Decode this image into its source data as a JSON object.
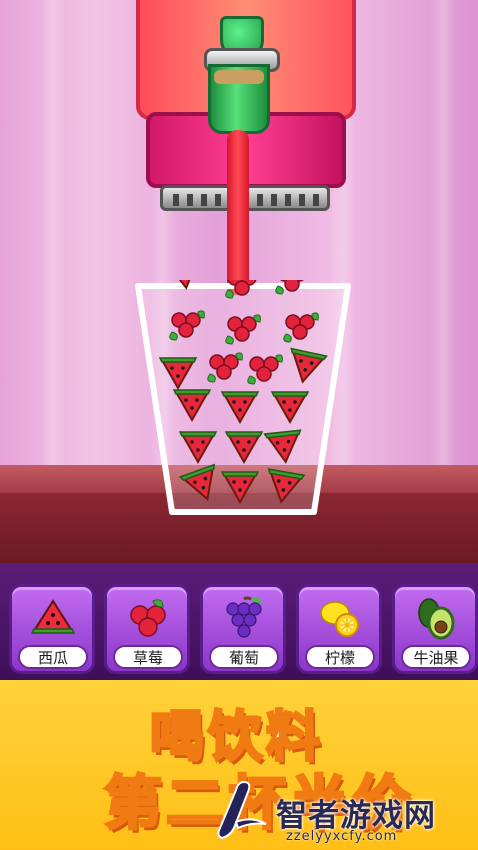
{
  "colors": {
    "stream": "#e8233a",
    "item_card": "#a34fe0",
    "banner": "#ffc72a"
  },
  "fruits": [
    {
      "id": "watermelon",
      "label": "西瓜",
      "icon": "watermelon-icon"
    },
    {
      "id": "strawberry",
      "label": "草莓",
      "icon": "strawberry-icon"
    },
    {
      "id": "grape",
      "label": "葡萄",
      "icon": "grape-icon"
    },
    {
      "id": "lemon",
      "label": "柠檬",
      "icon": "lemon-icon"
    },
    {
      "id": "avocado",
      "label": "牛油果",
      "icon": "avocado-icon"
    }
  ],
  "banner": {
    "line1": "喝饮料",
    "line2": "第二杯半价"
  },
  "watermark": {
    "name": "智者游戏网",
    "url": "zzelyyxcfy.com"
  }
}
